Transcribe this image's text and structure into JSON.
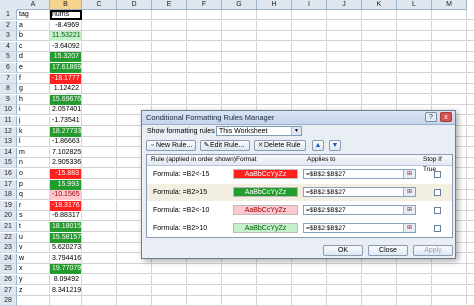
{
  "sheet": {
    "columns": [
      "A",
      "B",
      "C",
      "D",
      "E",
      "F",
      "G",
      "H",
      "I",
      "J",
      "K",
      "L",
      "M"
    ],
    "rows": [
      {
        "n": "1",
        "a": "tag",
        "b": "nums",
        "fmt": ""
      },
      {
        "n": "2",
        "a": "a",
        "b": "-8.4969",
        "fmt": ""
      },
      {
        "n": "3",
        "a": "b",
        "b": "11.53221",
        "fmt": "light"
      },
      {
        "n": "4",
        "a": "c",
        "b": "-3.64092",
        "fmt": ""
      },
      {
        "n": "5",
        "a": "d",
        "b": "15.3207",
        "fmt": "green"
      },
      {
        "n": "6",
        "a": "e",
        "b": "17.61869",
        "fmt": "green"
      },
      {
        "n": "7",
        "a": "f",
        "b": "-18.1777",
        "fmt": "red"
      },
      {
        "n": "8",
        "a": "g",
        "b": "1.12422",
        "fmt": ""
      },
      {
        "n": "9",
        "a": "h",
        "b": "15.69676",
        "fmt": "green"
      },
      {
        "n": "10",
        "a": "i",
        "b": "2.057401",
        "fmt": ""
      },
      {
        "n": "11",
        "a": "j",
        "b": "-1.73541",
        "fmt": ""
      },
      {
        "n": "12",
        "a": "k",
        "b": "18.27733",
        "fmt": "green"
      },
      {
        "n": "13",
        "a": "l",
        "b": "-1.86663",
        "fmt": ""
      },
      {
        "n": "14",
        "a": "m",
        "b": "7.102825",
        "fmt": ""
      },
      {
        "n": "15",
        "a": "n",
        "b": "2.905336",
        "fmt": ""
      },
      {
        "n": "16",
        "a": "o",
        "b": "-15.883",
        "fmt": "red"
      },
      {
        "n": "17",
        "a": "p",
        "b": "15.993",
        "fmt": "green"
      },
      {
        "n": "18",
        "a": "q",
        "b": "-10.1565",
        "fmt": "pink"
      },
      {
        "n": "19",
        "a": "r",
        "b": "-18.3176",
        "fmt": "red"
      },
      {
        "n": "20",
        "a": "s",
        "b": "-6.88317",
        "fmt": ""
      },
      {
        "n": "21",
        "a": "t",
        "b": "18.18015",
        "fmt": "green"
      },
      {
        "n": "22",
        "a": "u",
        "b": "15.58157",
        "fmt": "green"
      },
      {
        "n": "23",
        "a": "v",
        "b": "5.620273",
        "fmt": ""
      },
      {
        "n": "24",
        "a": "w",
        "b": "3.794416",
        "fmt": ""
      },
      {
        "n": "25",
        "a": "x",
        "b": "19.77079",
        "fmt": "green"
      },
      {
        "n": "26",
        "a": "y",
        "b": "8.09492",
        "fmt": ""
      },
      {
        "n": "27",
        "a": "z",
        "b": "8.341219",
        "fmt": ""
      },
      {
        "n": "28",
        "a": "",
        "b": "",
        "fmt": ""
      }
    ]
  },
  "dialog": {
    "title": "Conditional Formatting Rules Manager",
    "help": "?",
    "close": "x",
    "show_label": "Show formatting rules for:",
    "show_value": "This Worksheet",
    "buttons": {
      "new_rule": "New Rule...",
      "edit_rule": "Edit Rule...",
      "delete_rule": "Delete Rule",
      "move_up": "▲",
      "move_down": "▼"
    },
    "table_headers": {
      "rule": "Rule (applied in order shown)",
      "format": "Format",
      "applies": "Applies to",
      "stop": "Stop If True"
    },
    "rules": [
      {
        "rule": "Formula: =B2<-15",
        "format": "AaBbCcYyZz",
        "applies": "=$B$2:$B$27",
        "style": "red"
      },
      {
        "rule": "Formula: =B2>15",
        "format": "AaBbCcYyZz",
        "applies": "=$B$2:$B$27",
        "style": "green"
      },
      {
        "rule": "Formula: =B2<-10",
        "format": "AaBbCcYyZz",
        "applies": "=$B$2:$B$27",
        "style": "pink"
      },
      {
        "rule": "Formula: =B2>10",
        "format": "AaBbCcYyZz",
        "applies": "=$B$2:$B$27",
        "style": "light"
      }
    ],
    "footer": {
      "ok": "OK",
      "close": "Close",
      "apply": "Apply"
    }
  },
  "colors": {
    "green_fill": "#239b2d",
    "red_fill": "#ff2020",
    "light_green_fill": "#c6efce",
    "pink_fill": "#ffc7ce"
  }
}
